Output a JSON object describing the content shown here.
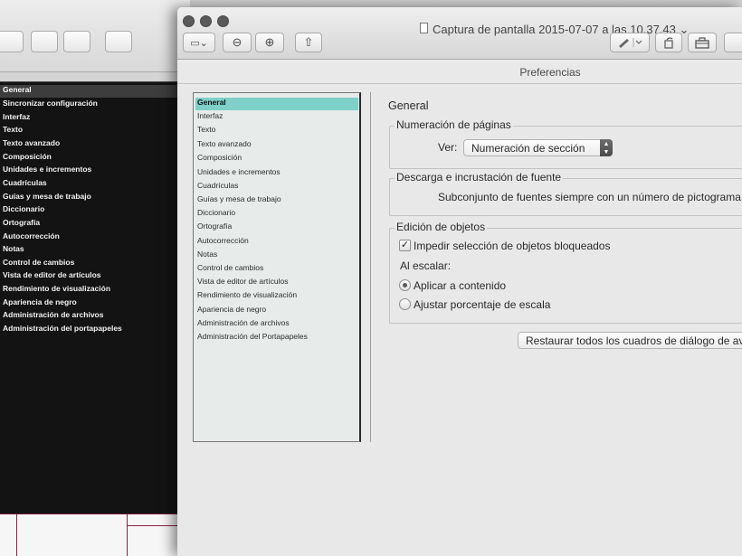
{
  "back_window": {
    "categories": [
      "General",
      "Sincronizar configuración",
      "Interfaz",
      "Texto",
      "Texto avanzado",
      "Composición",
      "Unidades e incrementos",
      "Cuadrículas",
      "Guías y mesa de trabajo",
      "Diccionario",
      "Ortografía",
      "Autocorrección",
      "Notas",
      "Control de cambios",
      "Vista de editor de artículos",
      "Rendimiento de visualización",
      "Apariencia de negro",
      "Administración de archivos",
      "Administración del portapapeles"
    ],
    "selected_index": 0
  },
  "window": {
    "title": "Captura de pantalla 2015-07-07 a las 10.37.43",
    "title_chevron": "⌄",
    "sidebar_toggle": "▭⌄",
    "zoom_out": "⊖",
    "zoom_in": "⊕",
    "share": "⇧"
  },
  "prefs": {
    "title": "Preferencias",
    "categories": [
      "General",
      "Interfaz",
      "Texto",
      "Texto avanzado",
      "Composición",
      "Unidades e incrementos",
      "Cuadrículas",
      "Guías y mesa de trabajo",
      "Diccionario",
      "Ortografía",
      "Autocorrección",
      "Notas",
      "Control de cambios",
      "Vista de editor de artículos",
      "Rendimiento de visualización",
      "Apariencia de negro",
      "Administración de archivos",
      "Administración del Portapapeles"
    ],
    "selected_index": 0,
    "panel_title": "General",
    "page_numbering": {
      "group_label": "Numeración de páginas",
      "view_label": "Ver:",
      "view_value": "Numeración de sección"
    },
    "fonts": {
      "group_label": "Descarga e incrustación de fuente",
      "text": "Subconjunto de fuentes siempre con un número de pictograma"
    },
    "object_editing": {
      "group_label": "Edición de objetos",
      "prevent_locked_label": "Impedir selección de objetos bloqueados",
      "prevent_locked_checked": true,
      "when_scaling_label": "Al escalar:",
      "apply_to_content_label": "Aplicar a contenido",
      "adjust_scale_label": "Ajustar porcentaje de escala",
      "scaling_choice": "apply_to_content"
    },
    "reset_dialogs_label": "Restaurar todos los cuadros de diálogo de av"
  }
}
